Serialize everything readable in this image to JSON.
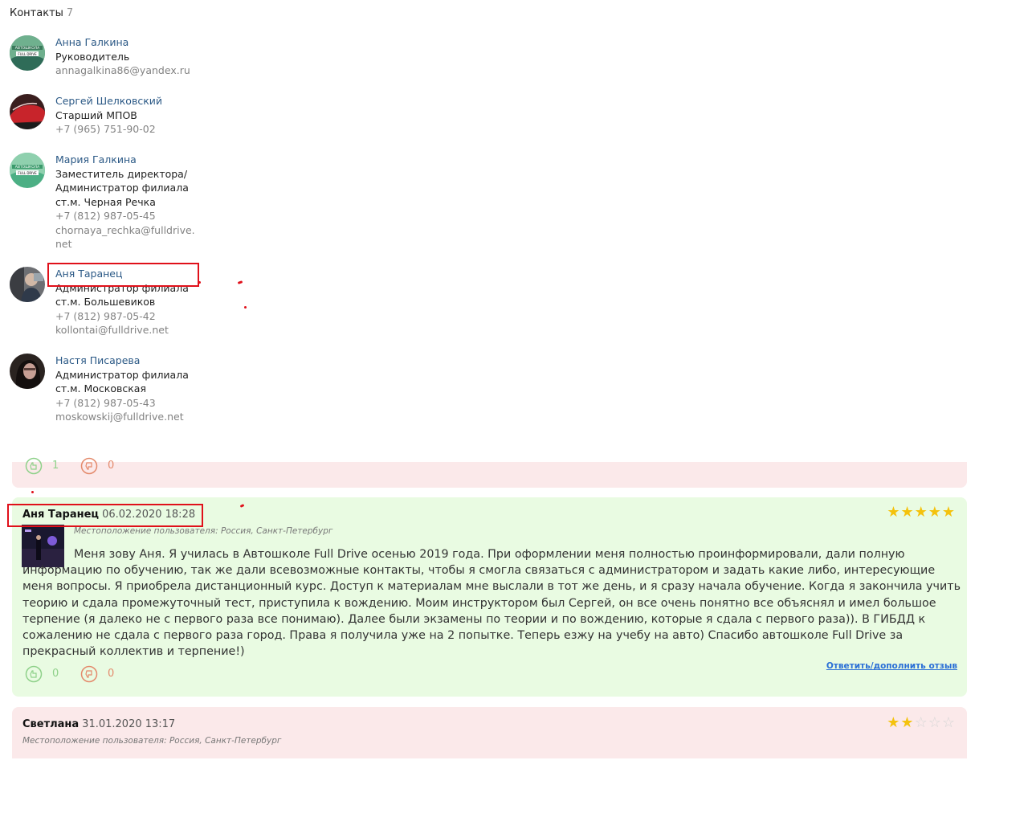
{
  "contacts": {
    "title": "Контакты",
    "count": "7",
    "items": [
      {
        "name": "Анна Галкина",
        "lines": [
          "Руководитель"
        ],
        "info": [
          "annagalkina86@yandex.ru"
        ],
        "avatar": "autoschool-logo"
      },
      {
        "name": "Сергей Шелковский",
        "lines": [
          "Старший МПОВ"
        ],
        "info": [
          "+7 (965) 751-90-02"
        ],
        "avatar": "red-car"
      },
      {
        "name": "Мария Галкина",
        "lines": [
          "Заместитель директора/",
          "Администратор филиала",
          "ст.м. Черная Речка"
        ],
        "info": [
          "+7 (812) 987-05-45",
          "chornaya_rechka@fulldrive.",
          "net"
        ],
        "avatar": "autoschool-logo"
      },
      {
        "name": "Аня Таранец",
        "lines": [
          "Администратор филиала",
          "ст.м. Большевиков"
        ],
        "info": [
          "+7 (812) 987-05-42",
          "kollontai@fulldrive.net"
        ],
        "avatar": "person-photo"
      },
      {
        "name": "Настя Писарева",
        "lines": [
          "Администратор филиала",
          "ст.м. Московская"
        ],
        "info": [
          "+7 (812) 987-05-43",
          "moskowskij@fulldrive.net"
        ],
        "avatar": "person-photo-dark"
      }
    ]
  },
  "reviews": [
    {
      "likes": "1",
      "dislikes": "0"
    },
    {
      "author": "Аня Таранец",
      "date": "06.02.2020 18:28",
      "location": "Местоположение пользователя: Россия, Санкт-Петербург",
      "rating": 5,
      "text": "Меня зову Аня. Я училась в Автошколе Full Drive осенью 2019 года. При оформлении меня полностью проинформировали, дали полную информацию по обучению, так же дали всевозможные контакты, чтобы я смогла связаться с администратором  и задать какие либо, интересующие меня вопросы. Я приобрела дистанционный курс. Доступ к материалам мне выслали в тот же день, и я сразу начала обучение. Когда я закончила учить теорию и сдала промежуточный тест, приступила к вождению. Моим инструктором был Сергей, он все очень понятно все объяснял и имел большое терпение (я далеко не с первого раза все понимаю). Далее были экзамены по теории и по вождению, которые я сдала с первого раза)). В ГИБДД к сожалению не сдала с первого раза город. Права я получила уже на 2 попытке. Теперь езжу на учебу на авто) Спасибо автошколе Full Drive за прекрасный коллектив и терпение!)",
      "likes": "0",
      "dislikes": "0",
      "reply_label": "Ответить/дополнить отзыв"
    },
    {
      "author": "Светлана",
      "date": "31.01.2020 13:17",
      "location": "Местоположение пользователя: Россия, Санкт-Петербург",
      "rating": 2
    }
  ],
  "colors": {
    "accent_link": "#2a5885",
    "star": "#f4c20d",
    "annotation": "#e0101a",
    "positive_bg": "#e9fbe2",
    "negative_bg": "#fbe9ea"
  }
}
